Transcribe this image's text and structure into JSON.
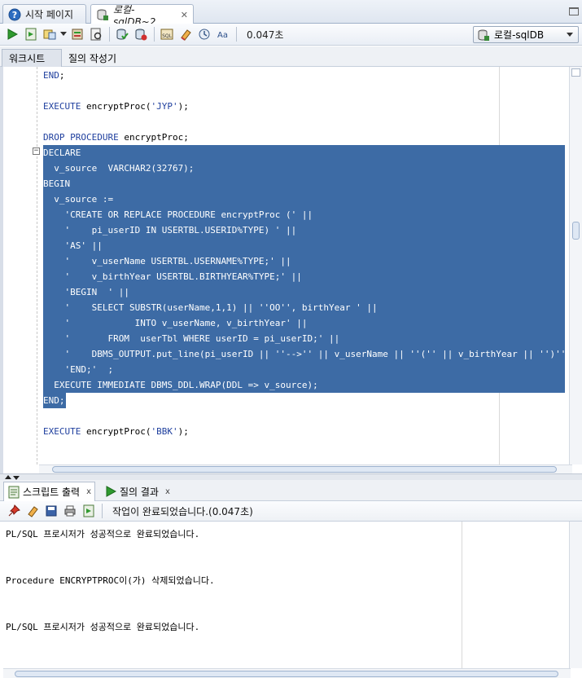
{
  "doc_tabs": [
    {
      "label": "시작 페이지",
      "icon": "help-circle-icon"
    },
    {
      "label": "로컬-sqlDB~2",
      "icon": "sql-worksheet-icon"
    }
  ],
  "toolbar": {
    "elapsed": "0.047초",
    "connection": "로컬-sqlDB",
    "buttons": [
      "run-statement",
      "run-script",
      "commit",
      "rollback",
      "explain-plan",
      "autotrace",
      "sql-tuning",
      "clear",
      "history",
      "format"
    ]
  },
  "subtabs": [
    "워크시트",
    "질의 작성기"
  ],
  "editor": {
    "lines": [
      {
        "text": "END;"
      },
      {
        "text": ""
      },
      {
        "text": "EXECUTE encryptProc('JYP');"
      },
      {
        "text": ""
      },
      {
        "text": "DROP PROCEDURE encryptProc;"
      },
      {
        "text": "DECLARE"
      },
      {
        "text": "  v_source  VARCHAR2(32767);"
      },
      {
        "text": "BEGIN"
      },
      {
        "text": "  v_source :="
      },
      {
        "text": "    'CREATE OR REPLACE PROCEDURE encryptProc (' ||"
      },
      {
        "text": "    '    pi_userID IN USERTBL.USERID%TYPE) ' ||"
      },
      {
        "text": "    'AS' ||"
      },
      {
        "text": "    '    v_userName USERTBL.USERNAME%TYPE;' ||"
      },
      {
        "text": "    '    v_birthYear USERTBL.BIRTHYEAR%TYPE;' ||"
      },
      {
        "text": "    'BEGIN  ' ||"
      },
      {
        "text": "    '    SELECT SUBSTR(userName,1,1) || ''OO'', birthYear ' ||"
      },
      {
        "text": "    '            INTO v_userName, v_birthYear' ||"
      },
      {
        "text": "    '       FROM  userTbl WHERE userID = pi_userID;' ||"
      },
      {
        "text": "    '    DBMS_OUTPUT.put_line(pi_userID || ''-->'' || v_userName || ''('' || v_birthYear || '')'');' ||"
      },
      {
        "text": "    'END;'  ;"
      },
      {
        "text": "  EXECUTE IMMEDIATE DBMS_DDL.WRAP(DDL => v_source);"
      },
      {
        "text": "END;"
      },
      {
        "text": ""
      },
      {
        "text": "EXECUTE encryptProc('BBK');"
      }
    ]
  },
  "output_tabs": [
    {
      "label": "스크립트 출력",
      "icon": "script-output-icon",
      "close": "x"
    },
    {
      "label": "질의 결과",
      "icon": "run-icon",
      "close": "x"
    }
  ],
  "output_toolbar": {
    "status": "작업이 완료되었습니다.(0.047초)"
  },
  "output": {
    "lines": [
      "PL/SQL 프로시저가 성공적으로 완료되었습니다.",
      "Procedure ENCRYPTPROC이(가) 삭제되었습니다.",
      "PL/SQL 프로시저가 성공적으로 완료되었습니다."
    ]
  },
  "colors": {
    "selection": "#3d6ba5",
    "keyword": "#1f3f9e"
  }
}
